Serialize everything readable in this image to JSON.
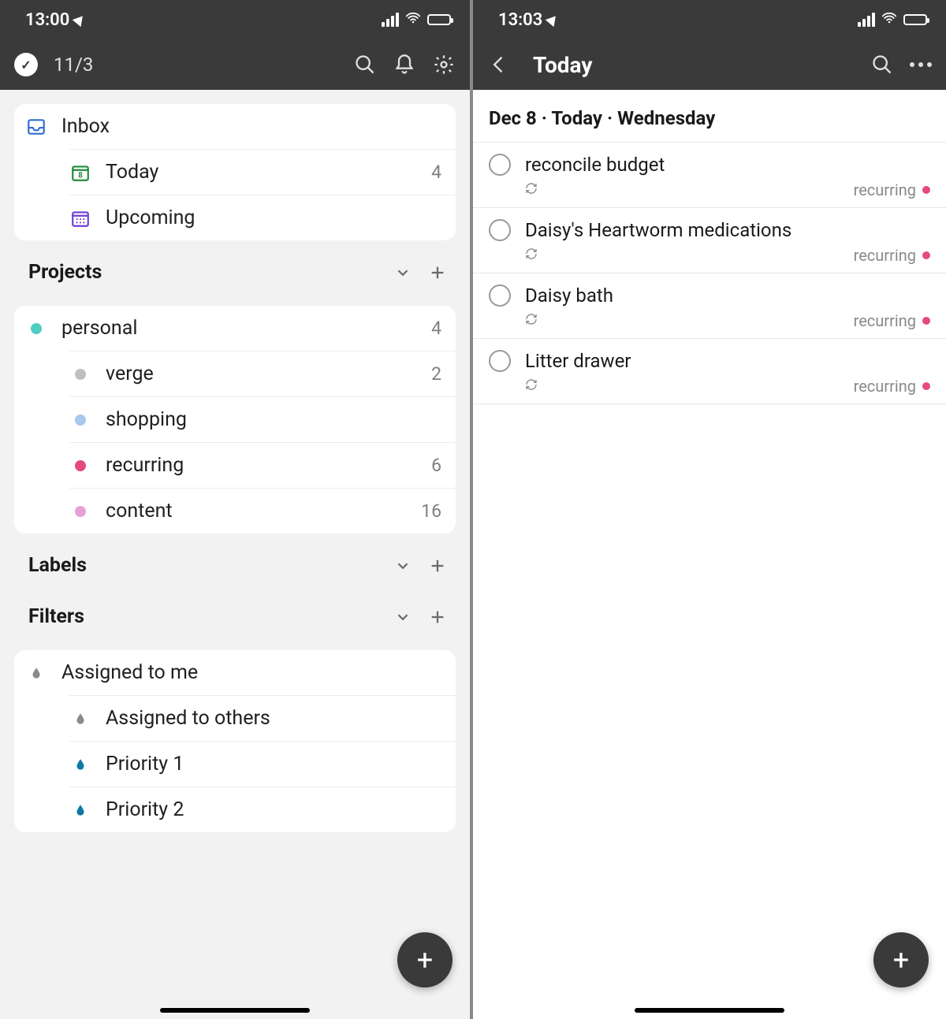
{
  "left": {
    "status_time": "13:00",
    "nav_count": "11/3",
    "views": [
      {
        "label": "Inbox",
        "count": ""
      },
      {
        "label": "Today",
        "count": "4"
      },
      {
        "label": "Upcoming",
        "count": ""
      }
    ],
    "projects_title": "Projects",
    "projects": [
      {
        "label": "personal",
        "count": "4",
        "color": "#4ecdc4"
      },
      {
        "label": "verge",
        "count": "2",
        "color": "#bfbfbf"
      },
      {
        "label": "shopping",
        "count": "",
        "color": "#a9c7ec"
      },
      {
        "label": "recurring",
        "count": "6",
        "color": "#e64980"
      },
      {
        "label": "content",
        "count": "16",
        "color": "#e8a0d8"
      }
    ],
    "labels_title": "Labels",
    "filters_title": "Filters",
    "filters": [
      {
        "label": "Assigned to me",
        "color": "#8a8a8a"
      },
      {
        "label": "Assigned to others",
        "color": "#8a8a8a"
      },
      {
        "label": "Priority 1",
        "color": "#0d7aa3"
      },
      {
        "label": "Priority 2",
        "color": "#0d7aa3"
      }
    ]
  },
  "right": {
    "status_time": "13:03",
    "nav_title": "Today",
    "date_header": "Dec 8 · Today · Wednesday",
    "recurring_label": "recurring",
    "tasks": [
      {
        "title": "reconcile budget"
      },
      {
        "title": "Daisy's Heartworm medications"
      },
      {
        "title": "Daisy bath"
      },
      {
        "title": "Litter drawer"
      }
    ]
  }
}
